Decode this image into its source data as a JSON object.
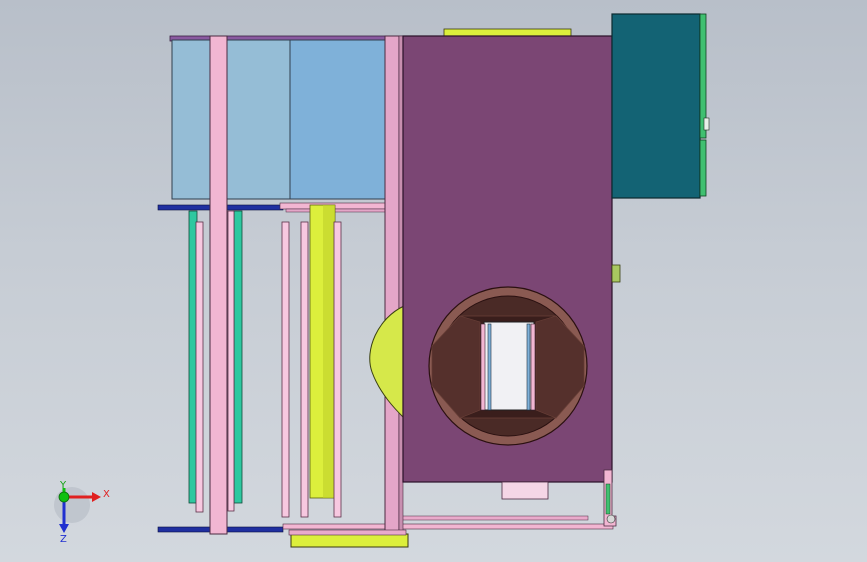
{
  "triad": {
    "x_label": "X",
    "y_label": "Y",
    "z_label": "Z",
    "x_color": "#e02020",
    "y_color": "#10c010",
    "z_color": "#2030d0"
  },
  "colors": {
    "background_top": "#b8bfc9",
    "background_bottom": "#d3d8de",
    "housing": "#7b4674",
    "cabinet": "#136374",
    "panel_light": "#95bdd6",
    "panel_mid": "#7fb1d9",
    "pink_rail": "#f2b6d2",
    "rail_blue": "#1f2fa0",
    "yellow_green": "#dcef3c",
    "teal_tube": "#2ec8a0",
    "duct_dark": "#4a2a26",
    "duct_ring": "#8a5a52"
  },
  "icons": {
    "triad": "axis-triad-icon"
  }
}
